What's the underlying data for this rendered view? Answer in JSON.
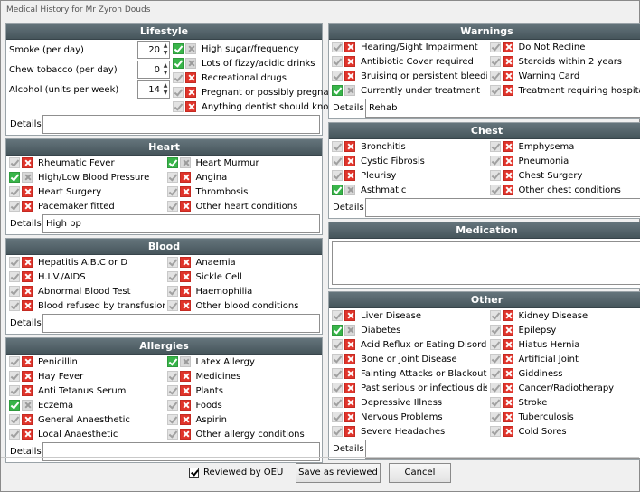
{
  "window": {
    "title": "Medical History for Mr Zyron Douds"
  },
  "details_label": "Details",
  "lifestyle": {
    "title": "Lifestyle",
    "numbers": [
      {
        "label": "Smoke (per day)",
        "value": "20"
      },
      {
        "label": "Chew tobacco (per day)",
        "value": "0"
      },
      {
        "label": "Alcohol (units per week)",
        "value": "14"
      }
    ],
    "items": [
      {
        "label": "High sugar/frequency",
        "state": "yes"
      },
      {
        "label": "Lots of fizzy/acidic drinks",
        "state": "yes"
      },
      {
        "label": "Recreational drugs",
        "state": "no"
      },
      {
        "label": "Pregnant or possibly pregnant",
        "state": "no"
      },
      {
        "label": "Anything dentist should know",
        "state": "no"
      }
    ],
    "details": ""
  },
  "heart": {
    "title": "Heart",
    "col1": [
      {
        "label": "Rheumatic Fever",
        "state": "no"
      },
      {
        "label": "High/Low Blood Pressure",
        "state": "yes"
      },
      {
        "label": "Heart Surgery",
        "state": "no"
      },
      {
        "label": "Pacemaker fitted",
        "state": "no"
      }
    ],
    "col2": [
      {
        "label": "Heart Murmur",
        "state": "yes"
      },
      {
        "label": "Angina",
        "state": "no"
      },
      {
        "label": "Thrombosis",
        "state": "no"
      },
      {
        "label": "Other heart conditions",
        "state": "no"
      }
    ],
    "details": "High bp"
  },
  "blood": {
    "title": "Blood",
    "col1": [
      {
        "label": "Hepatitis A.B.C or D",
        "state": "no"
      },
      {
        "label": "H.I.V./AIDS",
        "state": "no"
      },
      {
        "label": "Abnormal Blood Test",
        "state": "no"
      },
      {
        "label": "Blood refused by transfusion svce.",
        "state": "no"
      }
    ],
    "col2": [
      {
        "label": "Anaemia",
        "state": "no"
      },
      {
        "label": "Sickle Cell",
        "state": "no"
      },
      {
        "label": "Haemophilia",
        "state": "no"
      },
      {
        "label": "Other blood conditions",
        "state": "no"
      }
    ],
    "details": ""
  },
  "allergies": {
    "title": "Allergies",
    "col1": [
      {
        "label": "Penicillin",
        "state": "no"
      },
      {
        "label": "Hay Fever",
        "state": "no"
      },
      {
        "label": "Anti Tetanus Serum",
        "state": "no"
      },
      {
        "label": "Eczema",
        "state": "yes"
      },
      {
        "label": "General Anaesthetic",
        "state": "no"
      },
      {
        "label": "Local Anaesthetic",
        "state": "no"
      }
    ],
    "col2": [
      {
        "label": "Latex Allergy",
        "state": "yes"
      },
      {
        "label": "Medicines",
        "state": "no"
      },
      {
        "label": "Plants",
        "state": "no"
      },
      {
        "label": "Foods",
        "state": "no"
      },
      {
        "label": "Aspirin",
        "state": "no"
      },
      {
        "label": "Other allergy conditions",
        "state": "no"
      }
    ],
    "details": ""
  },
  "warnings": {
    "title": "Warnings",
    "col1": [
      {
        "label": "Hearing/Sight Impairment",
        "state": "no"
      },
      {
        "label": "Antibiotic Cover required",
        "state": "no"
      },
      {
        "label": "Bruising or persistent bleeding",
        "state": "no"
      },
      {
        "label": "Currently under treatment",
        "state": "yes"
      }
    ],
    "col2": [
      {
        "label": "Do Not Recline",
        "state": "no"
      },
      {
        "label": "Steroids within 2 years",
        "state": "no"
      },
      {
        "label": "Warning Card",
        "state": "no"
      },
      {
        "label": "Treatment requiring hospital",
        "state": "no"
      }
    ],
    "details": "Rehab"
  },
  "chest": {
    "title": "Chest",
    "col1": [
      {
        "label": "Bronchitis",
        "state": "no"
      },
      {
        "label": "Cystic Fibrosis",
        "state": "no"
      },
      {
        "label": "Pleurisy",
        "state": "no"
      },
      {
        "label": "Asthmatic",
        "state": "yes"
      }
    ],
    "col2": [
      {
        "label": "Emphysema",
        "state": "no"
      },
      {
        "label": "Pneumonia",
        "state": "no"
      },
      {
        "label": "Chest Surgery",
        "state": "no"
      },
      {
        "label": "Other chest conditions",
        "state": "no"
      }
    ],
    "details": ""
  },
  "medication": {
    "title": "Medication",
    "text": ""
  },
  "other": {
    "title": "Other",
    "col1": [
      {
        "label": "Liver Disease",
        "state": "no"
      },
      {
        "label": "Diabetes",
        "state": "yes"
      },
      {
        "label": "Acid Reflux or Eating Disorder",
        "state": "no"
      },
      {
        "label": "Bone or Joint Disease",
        "state": "no"
      },
      {
        "label": "Fainting Attacks or Blackouts",
        "state": "no"
      },
      {
        "label": "Past serious or infectious disease",
        "state": "no"
      },
      {
        "label": "Depressive Illness",
        "state": "no"
      },
      {
        "label": "Nervous Problems",
        "state": "no"
      },
      {
        "label": "Severe Headaches",
        "state": "no"
      }
    ],
    "col2": [
      {
        "label": "Kidney Disease",
        "state": "no"
      },
      {
        "label": "Epilepsy",
        "state": "no"
      },
      {
        "label": "Hiatus Hernia",
        "state": "no"
      },
      {
        "label": "Artificial Joint",
        "state": "no"
      },
      {
        "label": "Giddiness",
        "state": "no"
      },
      {
        "label": "Cancer/Radiotherapy",
        "state": "no"
      },
      {
        "label": "Stroke",
        "state": "no"
      },
      {
        "label": "Tuberculosis",
        "state": "no"
      },
      {
        "label": "Cold Sores",
        "state": "no"
      }
    ],
    "details": ""
  },
  "footer": {
    "reviewed_label": "Reviewed by OEU",
    "reviewed_checked": true,
    "save_label": "Save as reviewed",
    "cancel_label": "Cancel"
  },
  "colors": {
    "yes": "#39b54a",
    "no": "#e0342b",
    "header": "#4f5e64"
  }
}
